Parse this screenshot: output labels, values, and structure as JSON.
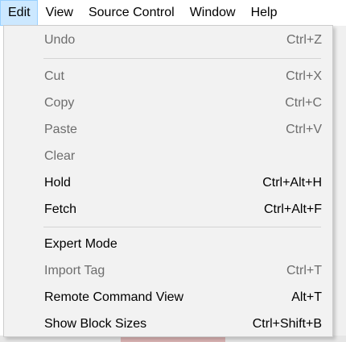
{
  "menubar": {
    "items": [
      {
        "label": "Edit"
      },
      {
        "label": "View"
      },
      {
        "label": "Source Control"
      },
      {
        "label": "Window"
      },
      {
        "label": "Help"
      }
    ]
  },
  "edit_menu": {
    "undo": {
      "label": "Undo",
      "shortcut": "Ctrl+Z",
      "enabled": false
    },
    "cut": {
      "label": "Cut",
      "shortcut": "Ctrl+X",
      "enabled": false
    },
    "copy": {
      "label": "Copy",
      "shortcut": "Ctrl+C",
      "enabled": false
    },
    "paste": {
      "label": "Paste",
      "shortcut": "Ctrl+V",
      "enabled": false
    },
    "clear": {
      "label": "Clear",
      "shortcut": "",
      "enabled": false
    },
    "hold": {
      "label": "Hold",
      "shortcut": "Ctrl+Alt+H",
      "enabled": true
    },
    "fetch": {
      "label": "Fetch",
      "shortcut": "Ctrl+Alt+F",
      "enabled": true
    },
    "expert_mode": {
      "label": "Expert Mode",
      "shortcut": "",
      "enabled": true
    },
    "import_tag": {
      "label": "Import Tag",
      "shortcut": "Ctrl+T",
      "enabled": false
    },
    "remote_command_view": {
      "label": "Remote Command View",
      "shortcut": "Alt+T",
      "enabled": true
    },
    "show_block_sizes": {
      "label": "Show Block Sizes",
      "shortcut": "Ctrl+Shift+B",
      "enabled": true
    }
  },
  "colors": {
    "active_menu_bg": "#cce8ff",
    "active_menu_border": "#99d1ff",
    "menu_bg": "#f2f2f2",
    "disabled_text": "#6d6d6d",
    "enabled_text": "#000000"
  }
}
